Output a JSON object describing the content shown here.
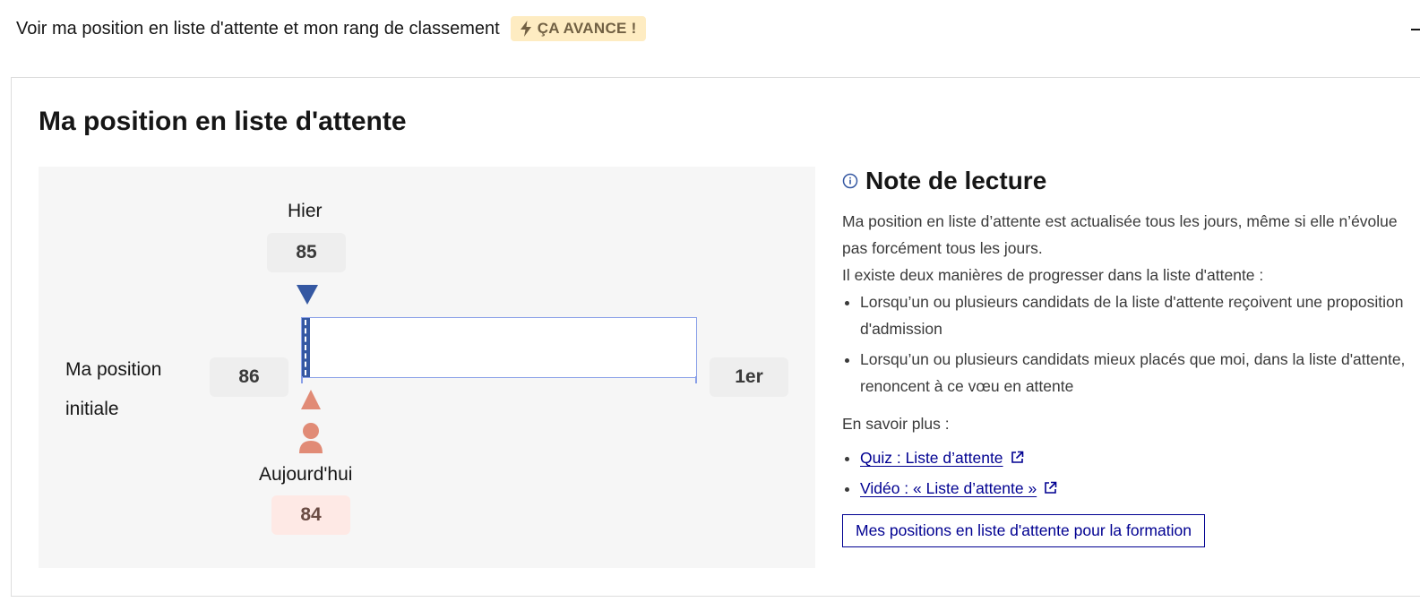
{
  "accordion": {
    "title": "Voir ma position en liste d'attente et mon rang de classement",
    "badge": "ÇA AVANCE !"
  },
  "panel": {
    "title": "Ma position en liste d'attente"
  },
  "position_widget": {
    "yesterday_label": "Hier",
    "yesterday_value": "85",
    "initial_label_line1": "Ma position",
    "initial_label_line2": "initiale",
    "initial_value": "86",
    "first_label": "1er",
    "today_label": "Aujourd'hui",
    "today_value": "84",
    "progress_fraction": 0.02,
    "colors": {
      "yesterday_marker": "#3558a2",
      "today_marker": "#e18b76",
      "frame": "#8aa0e8"
    }
  },
  "note": {
    "title": "Note de lecture",
    "paragraph1": "Ma position en liste d’attente est actualisée tous les jours, même si elle n’évolue pas forcément tous les jours.",
    "paragraph2": "Il existe deux manières de progresser dans la liste d'attente :",
    "reasons": [
      "Lorsqu’un ou plusieurs candidats de la liste d'attente reçoivent une proposition d'admission",
      "Lorsqu’un ou plusieurs candidats mieux placés que moi, dans la liste d'attente, renoncent à ce vœu en attente"
    ],
    "more_label": "En savoir plus :",
    "links": [
      {
        "label": "Quiz : Liste d’attente"
      },
      {
        "label": "Vidéo : « Liste d’attente »"
      }
    ],
    "button_label": "Mes positions en liste d'attente pour la formation"
  }
}
